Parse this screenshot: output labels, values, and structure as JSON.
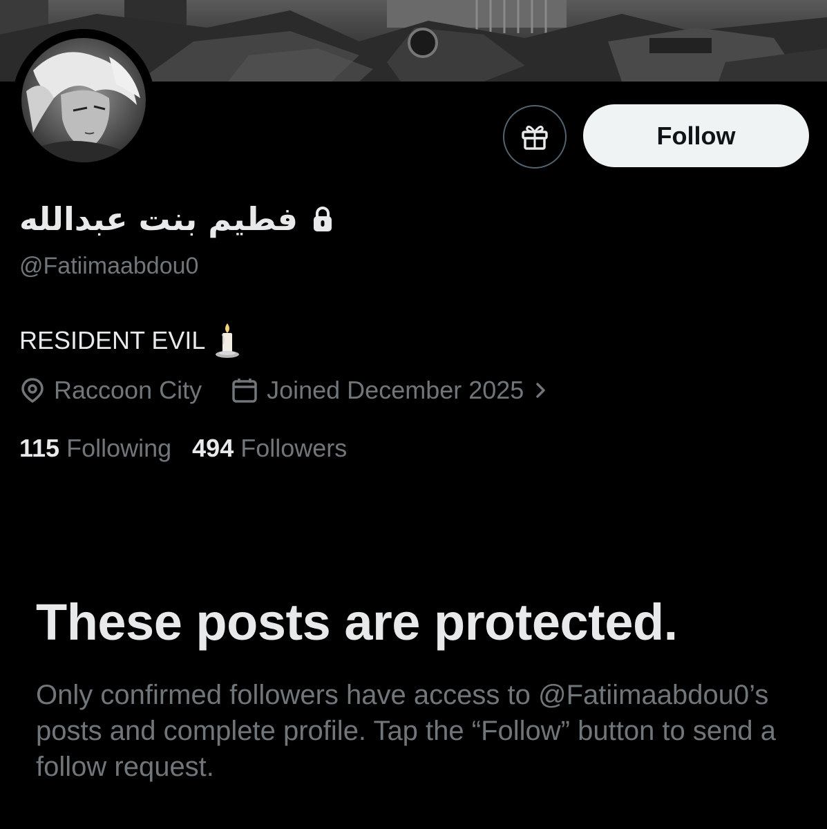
{
  "profile": {
    "display_name": "فطيم بنت عبدالله",
    "handle": "@Fatiimaabdou0",
    "bio": "RESIDENT EVIL",
    "bio_emoji": "candle",
    "location": "Raccoon City",
    "joined": "Joined December 2025",
    "following_count": "115",
    "following_label": "Following",
    "followers_count": "494",
    "followers_label": "Followers",
    "locked_icon": "lock-icon"
  },
  "actions": {
    "follow_label": "Follow",
    "gift_icon": "gift-icon"
  },
  "protected": {
    "title": "These posts are protected.",
    "description": "Only confirmed followers have access to @Fatiimaabdou0’s posts and complete profile. Tap the “Follow” button to send a follow request."
  },
  "colors": {
    "background": "#000000",
    "primary_text": "#e7e9ea",
    "secondary_text": "#71767b",
    "follow_button_bg": "#eff3f4",
    "follow_button_text": "#0f1419",
    "border": "#536471"
  }
}
